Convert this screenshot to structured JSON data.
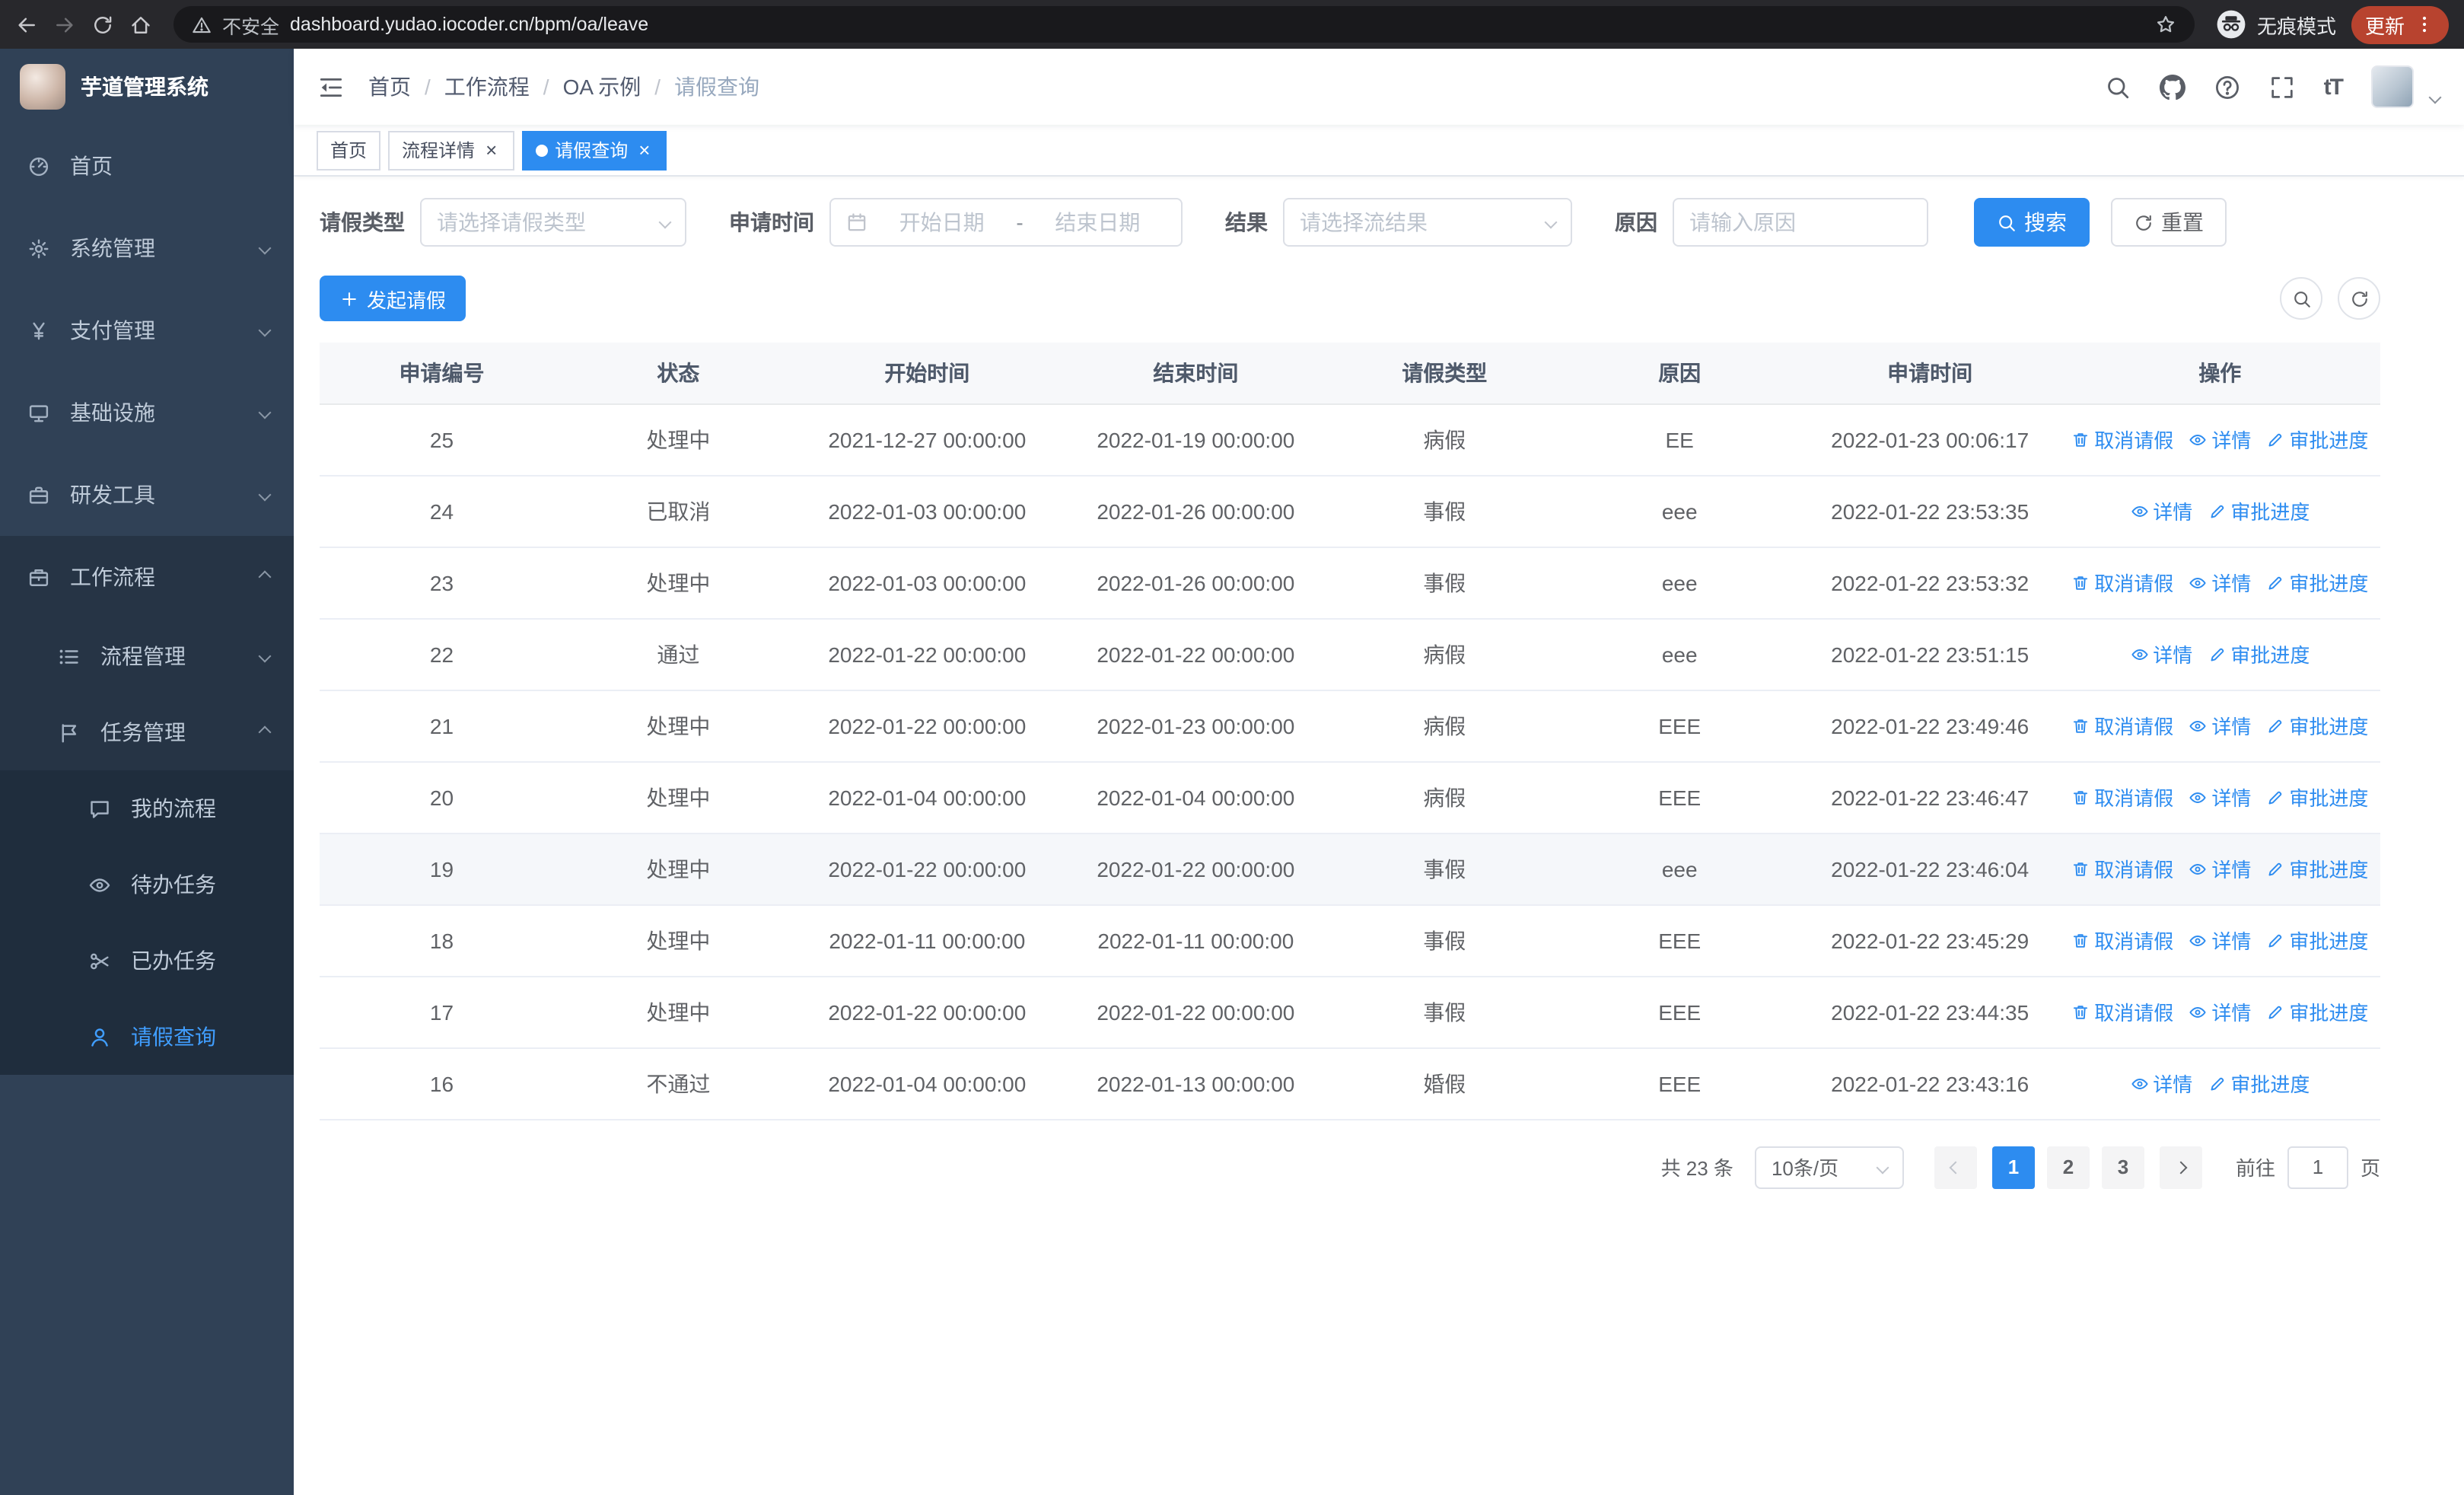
{
  "colors": {
    "primary": "#2d8cf0",
    "sidebar_bg": "#304156",
    "sidebar_sub_bg": "#263445",
    "sidebar_deep_bg": "#1f2d3d",
    "active_link": "#409eff"
  },
  "ui": {
    "close_glyph": "×"
  },
  "browser": {
    "security": "不安全",
    "url": "dashboard.yudao.iocoder.cn/bpm/oa/leave",
    "incognito": "无痕模式",
    "update": "更新"
  },
  "sidebar": {
    "title": "芋道管理系统",
    "menu": [
      {
        "label": "首页",
        "name": "home",
        "icon": "dashboard-icon",
        "level": 1
      },
      {
        "label": "系统管理",
        "name": "system-management",
        "icon": "gear-icon",
        "level": 1,
        "chevron": "down"
      },
      {
        "label": "支付管理",
        "name": "payment-management",
        "icon": "yen-icon",
        "level": 1,
        "chevron": "down"
      },
      {
        "label": "基础设施",
        "name": "infrastructure",
        "icon": "infra-icon",
        "level": 1,
        "chevron": "down"
      },
      {
        "label": "研发工具",
        "name": "dev-tools",
        "icon": "tools-icon",
        "level": 1,
        "chevron": "down"
      },
      {
        "label": "工作流程",
        "name": "workflow",
        "icon": "workflow-icon",
        "level": 1,
        "chevron": "up",
        "open": true
      },
      {
        "label": "流程管理",
        "name": "process-management",
        "icon": "process-icon",
        "level": 2,
        "chevron": "down"
      },
      {
        "label": "任务管理",
        "name": "task-management",
        "icon": "task-icon",
        "level": 2,
        "chevron": "up",
        "open": true
      },
      {
        "label": "我的流程",
        "name": "my-process",
        "icon": "my-process-icon",
        "level": 3
      },
      {
        "label": "待办任务",
        "name": "todo-tasks",
        "icon": "eye-icon",
        "level": 3
      },
      {
        "label": "已办任务",
        "name": "done-tasks",
        "icon": "done-icon",
        "level": 3
      },
      {
        "label": "请假查询",
        "name": "leave-query",
        "icon": "person-icon",
        "level": 3,
        "active": true
      }
    ]
  },
  "header": {
    "breadcrumbs": [
      "首页",
      "工作流程",
      "OA 示例",
      "请假查询"
    ],
    "separator": "/",
    "font_size_glyph": "tT"
  },
  "tabs": [
    {
      "label": "首页",
      "name": "tab-home",
      "closable": false,
      "active": false
    },
    {
      "label": "流程详情",
      "name": "tab-process-detail",
      "closable": true,
      "active": false
    },
    {
      "label": "请假查询",
      "name": "tab-leave-query",
      "closable": true,
      "active": true
    }
  ],
  "filters": {
    "type_label": "请假类型",
    "type_placeholder": "请选择请假类型",
    "time_label": "申请时间",
    "start_placeholder": "开始日期",
    "range_separator": "-",
    "end_placeholder": "结束日期",
    "result_label": "结果",
    "result_placeholder": "请选择流结果",
    "reason_label": "原因",
    "reason_placeholder": "请输入原因",
    "search": "搜索",
    "reset": "重置"
  },
  "toolbar": {
    "create": "发起请假"
  },
  "table": {
    "headers": [
      "申请编号",
      "状态",
      "开始时间",
      "结束时间",
      "请假类型",
      "原因",
      "申请时间",
      "操作"
    ],
    "action_labels": {
      "cancel": "取消请假",
      "detail": "详情",
      "progress": "审批进度"
    },
    "rows": [
      {
        "id": "25",
        "status": "处理中",
        "start": "2021-12-27 00:00:00",
        "end": "2022-01-19 00:00:00",
        "type": "病假",
        "reason": "EE",
        "applied": "2022-01-23 00:06:17",
        "actions": [
          "cancel",
          "detail",
          "progress"
        ]
      },
      {
        "id": "24",
        "status": "已取消",
        "start": "2022-01-03 00:00:00",
        "end": "2022-01-26 00:00:00",
        "type": "事假",
        "reason": "eee",
        "applied": "2022-01-22 23:53:35",
        "actions": [
          "detail",
          "progress"
        ]
      },
      {
        "id": "23",
        "status": "处理中",
        "start": "2022-01-03 00:00:00",
        "end": "2022-01-26 00:00:00",
        "type": "事假",
        "reason": "eee",
        "applied": "2022-01-22 23:53:32",
        "actions": [
          "cancel",
          "detail",
          "progress"
        ]
      },
      {
        "id": "22",
        "status": "通过",
        "start": "2022-01-22 00:00:00",
        "end": "2022-01-22 00:00:00",
        "type": "病假",
        "reason": "eee",
        "applied": "2022-01-22 23:51:15",
        "actions": [
          "detail",
          "progress"
        ]
      },
      {
        "id": "21",
        "status": "处理中",
        "start": "2022-01-22 00:00:00",
        "end": "2022-01-23 00:00:00",
        "type": "病假",
        "reason": "EEE",
        "applied": "2022-01-22 23:49:46",
        "actions": [
          "cancel",
          "detail",
          "progress"
        ]
      },
      {
        "id": "20",
        "status": "处理中",
        "start": "2022-01-04 00:00:00",
        "end": "2022-01-04 00:00:00",
        "type": "病假",
        "reason": "EEE",
        "applied": "2022-01-22 23:46:47",
        "actions": [
          "cancel",
          "detail",
          "progress"
        ]
      },
      {
        "id": "19",
        "status": "处理中",
        "start": "2022-01-22 00:00:00",
        "end": "2022-01-22 00:00:00",
        "type": "事假",
        "reason": "eee",
        "applied": "2022-01-22 23:46:04",
        "actions": [
          "cancel",
          "detail",
          "progress"
        ],
        "hover": true
      },
      {
        "id": "18",
        "status": "处理中",
        "start": "2022-01-11 00:00:00",
        "end": "2022-01-11 00:00:00",
        "type": "事假",
        "reason": "EEE",
        "applied": "2022-01-22 23:45:29",
        "actions": [
          "cancel",
          "detail",
          "progress"
        ]
      },
      {
        "id": "17",
        "status": "处理中",
        "start": "2022-01-22 00:00:00",
        "end": "2022-01-22 00:00:00",
        "type": "事假",
        "reason": "EEE",
        "applied": "2022-01-22 23:44:35",
        "actions": [
          "cancel",
          "detail",
          "progress"
        ]
      },
      {
        "id": "16",
        "status": "不通过",
        "start": "2022-01-04 00:00:00",
        "end": "2022-01-13 00:00:00",
        "type": "婚假",
        "reason": "EEE",
        "applied": "2022-01-22 23:43:16",
        "actions": [
          "detail",
          "progress"
        ]
      }
    ]
  },
  "pagination": {
    "total": "共 23 条",
    "page_size": "10条/页",
    "pages": [
      "1",
      "2",
      "3"
    ],
    "active_page": "1",
    "goto_label": "前往",
    "goto_value": "1",
    "page_label": "页"
  }
}
